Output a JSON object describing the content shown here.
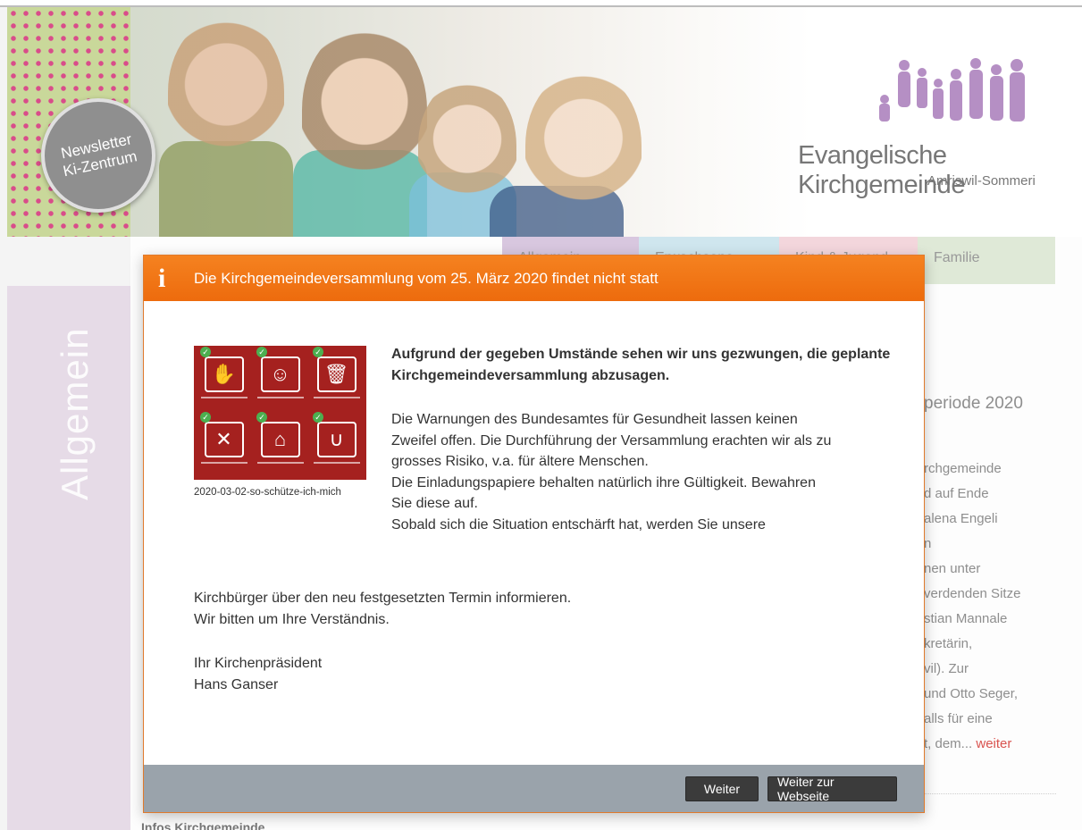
{
  "header": {
    "newsletter_line1": "Newsletter",
    "newsletter_line2": "Ki-Zentrum",
    "logo_title": "Evangelische Kirchgemeinde",
    "logo_subtitle": "Amriswil-Sommeri"
  },
  "nav": {
    "tab1": "Allgemein",
    "tab2": "Erwachsene",
    "tab3": "Kind & Jugend",
    "tab4": "Familie"
  },
  "sidebar": {
    "section_label": "Allgemein"
  },
  "right_column": {
    "heading": "periode 2020",
    "lines": [
      "rchgemeinde",
      "d auf Ende",
      "alena Engeli",
      "n",
      "nen unter",
      "verdenden Sitze",
      "stian Mannale",
      "kretärin,",
      "vil). Zur",
      "und Otto Seger,",
      "alls für eine",
      "t, dem..."
    ],
    "more_link": "weiter"
  },
  "bottom_title": "Infos Kirchgemeinde",
  "modal": {
    "title": "Die Kirchgemeindeversammlung vom 25. März 2020 findet nicht statt",
    "image_caption": "2020-03-02-so-schütze-ich-mich",
    "lead": "Aufgrund der gegeben Umstände sehen wir uns gezwungen, die geplante Kirchgemeindeversammlung abzusagen.",
    "para_lines": [
      "Die Warnungen des Bundesamtes für Gesundheit lassen keinen",
      "Zweifel offen. Die Durchführung der Versammlung erachten wir als zu",
      "grosses Risiko, v.a. für ältere Menschen.",
      "Die Einladungspapiere behalten natürlich ihre Gültigkeit. Bewahren",
      "Sie diese auf.",
      "Sobald sich die Situation entschärft hat, werden Sie unsere"
    ],
    "para2_lines": [
      "Kirchbürger über den neu festgesetzten Termin informieren.",
      "Wir bitten um Ihre Verständnis."
    ],
    "signature_role": "Ihr Kirchenpräsident",
    "signature_name": "Hans Ganser",
    "buttons": {
      "next": "Weiter",
      "to_website": "Weiter zur Webseite"
    }
  },
  "colors": {
    "header_orange": "#f58220",
    "footer_grey": "#9aa3ab",
    "button_dark": "#3b3b3b",
    "sidebar_mauve": "#e6dbe7"
  }
}
